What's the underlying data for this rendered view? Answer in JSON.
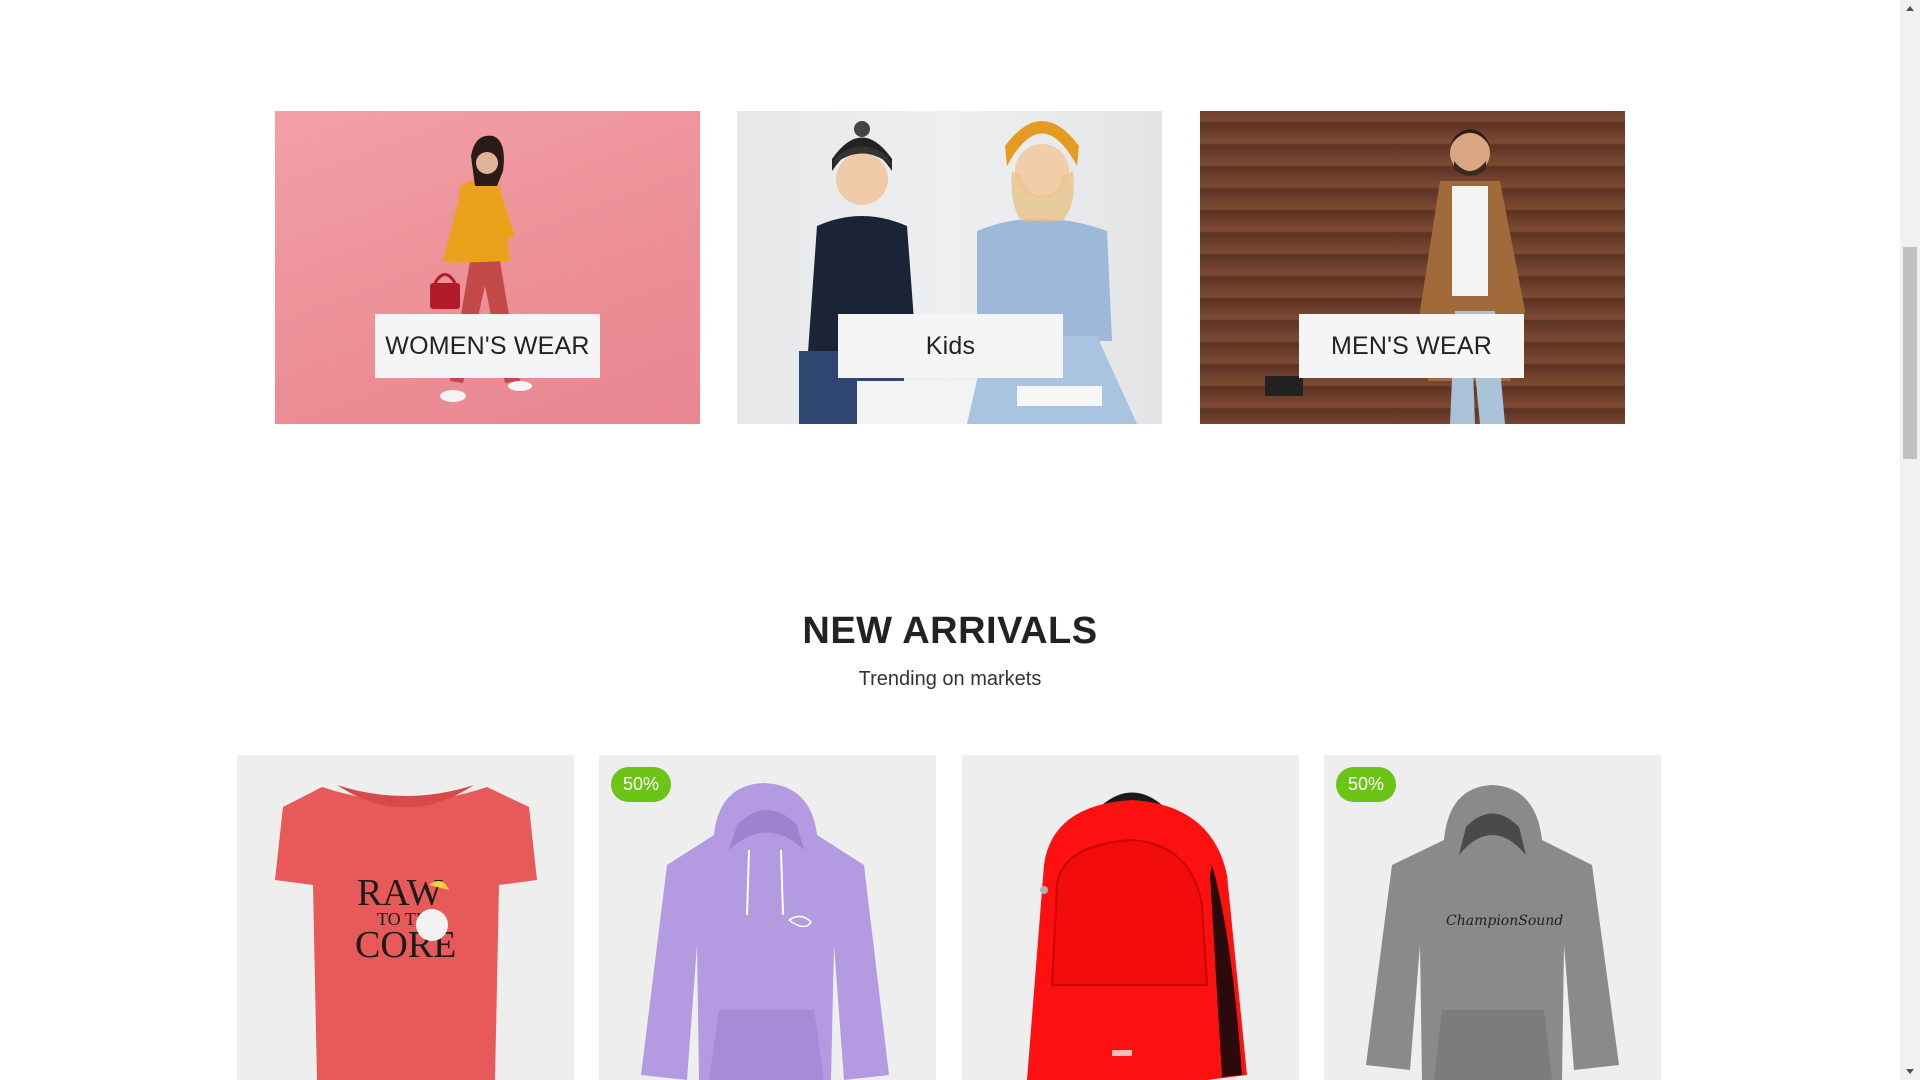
{
  "categories": [
    {
      "label": "WOMEN'S WEAR"
    },
    {
      "label": "Kids"
    },
    {
      "label": "MEN'S WEAR"
    }
  ],
  "new_arrivals": {
    "title": "NEW ARRIVALS",
    "subtitle": "Trending on markets"
  },
  "products": [
    {
      "name": "red t-shirt",
      "badge": "",
      "print": [
        "RAW",
        "TO THE",
        "CORE"
      ],
      "color": "#e85a5a"
    },
    {
      "name": "purple hoodie",
      "badge": "50%",
      "color": "#b49ae0"
    },
    {
      "name": "red backpack",
      "badge": "",
      "color": "#ff1010"
    },
    {
      "name": "grey hoodie",
      "badge": "50%",
      "print": [
        "ChampionSound"
      ],
      "color": "#8a8a8a"
    }
  ],
  "colors": {
    "badge": "#6cc417",
    "card_bg": "#eeeeef",
    "text": "#222222"
  }
}
